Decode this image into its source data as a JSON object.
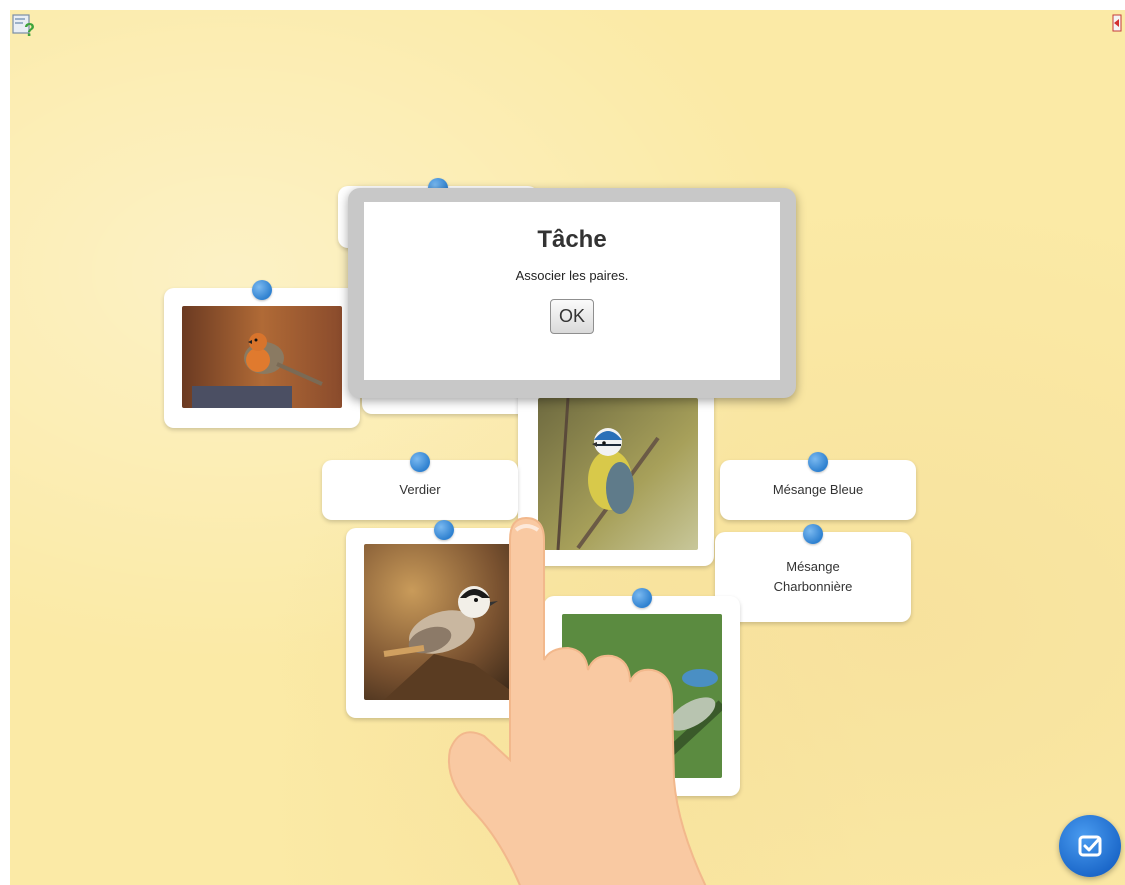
{
  "dialog": {
    "title": "Tâche",
    "message": "Associer les paires.",
    "ok_label": "OK"
  },
  "cards": {
    "verdier": "Verdier",
    "mesange_bleue": "Mésange Bleue",
    "mesange_charbonniere_line1": "Mésange",
    "mesange_charbonniere_line2": "Charbonnière"
  },
  "icons": {
    "help": "help-icon",
    "exit": "exit-icon",
    "check": "check-icon",
    "hand": "pointing-hand"
  },
  "colors": {
    "background": "#fbeaa6",
    "pin": "#2f81d0",
    "check_button": "#1a66c8",
    "dialog_frame": "#c8c8c8"
  }
}
